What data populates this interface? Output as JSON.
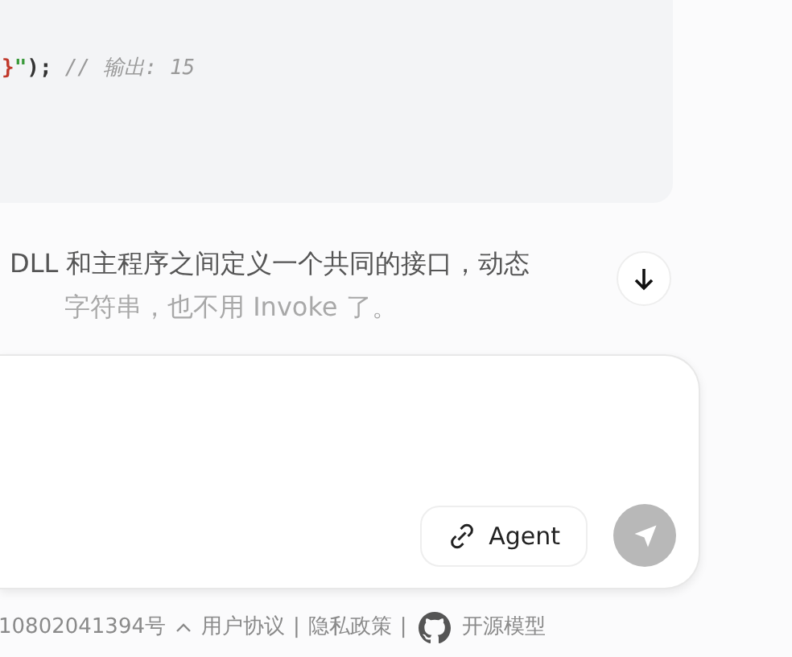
{
  "code_block": {
    "tokens": [
      {
        "kind": "punct-red",
        "text": "}"
      },
      {
        "kind": "string",
        "text": "\""
      },
      {
        "kind": "plain",
        "text": ");"
      },
      {
        "kind": "comment",
        "text": "// 输出: 15"
      }
    ]
  },
  "message": {
    "lines": [
      "DLL 和主程序之间定义一个共同的接口，动态",
      "字符串，也不用 Invoke 了。"
    ]
  },
  "scroll_down_button": {
    "kind": "arrow-down"
  },
  "composer": {
    "agent_button": {
      "label": "Agent"
    },
    "send_button": {
      "disabled": true
    }
  },
  "footer": {
    "items": [
      {
        "kind": "text",
        "text": "10802041394号"
      },
      {
        "kind": "caret"
      },
      {
        "kind": "link",
        "text": "用户协议"
      },
      {
        "kind": "sep",
        "text": "|"
      },
      {
        "kind": "link",
        "text": "隐私政策"
      },
      {
        "kind": "sep",
        "text": "|"
      },
      {
        "kind": "github"
      },
      {
        "kind": "link",
        "text": "开源模型"
      }
    ]
  }
}
